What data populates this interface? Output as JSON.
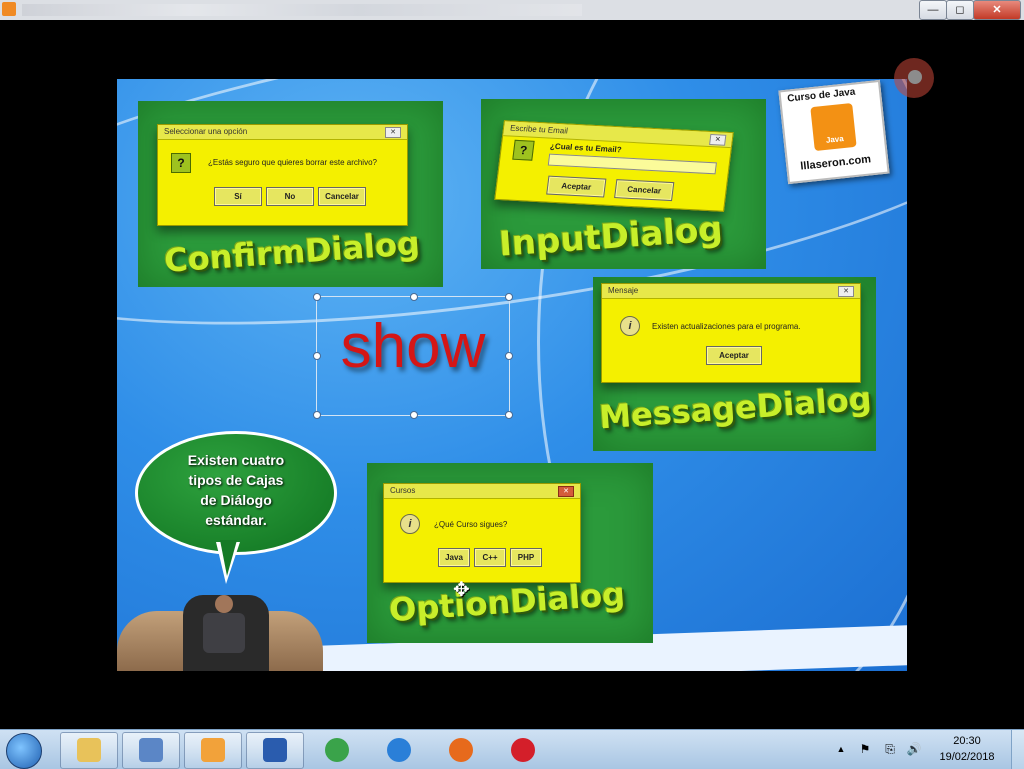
{
  "window": {
    "controls": {
      "minimize": "—",
      "maximize": "◻",
      "close": "✕"
    }
  },
  "slide": {
    "confirm": {
      "dialog_title": "Seleccionar una opción",
      "question": "¿Estás seguro que quieres borrar este archivo?",
      "icon_glyph": "?",
      "buttons": [
        "Sí",
        "No",
        "Cancelar"
      ],
      "label": "ConfirmDialog"
    },
    "input": {
      "dialog_title": "Escribe tu Email",
      "question": "¿Cual es tu Email?",
      "icon_glyph": "?",
      "buttons": [
        "Aceptar",
        "Cancelar"
      ],
      "label": "InputDialog"
    },
    "message": {
      "dialog_title": "Mensaje",
      "text": "Existen actualizaciones para el programa.",
      "icon_glyph": "i",
      "button": "Aceptar",
      "label": "MessageDialog"
    },
    "option": {
      "dialog_title": "Cursos",
      "question": "¿Qué Curso sigues?",
      "icon_glyph": "i",
      "buttons": [
        "Java",
        "C++",
        "PHP"
      ],
      "label": "OptionDialog"
    },
    "show_text": "show",
    "bubble": {
      "lines": [
        "Existen cuatro",
        "tipos de Cajas",
        "de Diálogo",
        "estándar."
      ]
    },
    "badge": {
      "top": "Curso de Java",
      "logo": "Java",
      "bottom": "lllaseron.com"
    }
  },
  "taskbar": {
    "apps": [
      {
        "name": "file-explorer",
        "color": "#e8c25a"
      },
      {
        "name": "virtualbox",
        "color": "#5b86c6"
      },
      {
        "name": "media-player",
        "color": "#f2a23a"
      },
      {
        "name": "word",
        "color": "#2a5cae"
      },
      {
        "name": "chrome",
        "color": "#3aa34a"
      },
      {
        "name": "internet-explorer",
        "color": "#2a7fd8"
      },
      {
        "name": "firefox",
        "color": "#e76a1c"
      },
      {
        "name": "opera",
        "color": "#d41f2a"
      }
    ],
    "tray": {
      "arrow": "▲",
      "flag": "⚑",
      "network": "⎘",
      "volume": "🔊"
    },
    "clock": {
      "time": "20:30",
      "date": "19/02/2018"
    }
  },
  "colors": {
    "stage_blue": "#2f8ee8",
    "panel_green": "#2b9a3b",
    "dialog_yellow": "#f4f000",
    "label_green": "#c8ef2a",
    "show_red": "#d41616"
  }
}
